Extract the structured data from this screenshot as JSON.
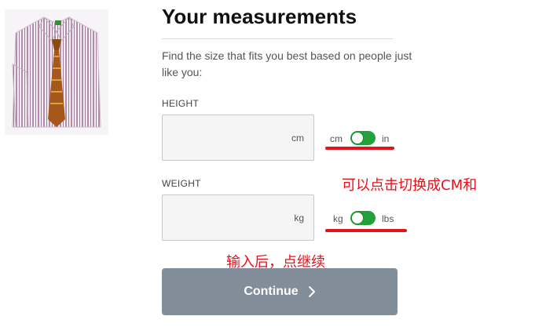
{
  "heading": "Your measurements",
  "subtitle": "Find the size that fits you best based on people just like you:",
  "height": {
    "label": "HEIGHT",
    "value": "",
    "unit_suffix": "cm",
    "toggle_left": "cm",
    "toggle_right": "in"
  },
  "weight": {
    "label": "WEIGHT",
    "value": "",
    "unit_suffix": "kg",
    "toggle_left": "kg",
    "toggle_right": "lbs"
  },
  "annotations": {
    "toggle_note": "可以点击切换成CM和",
    "continue_note": "输入后，点继续"
  },
  "continue_label": "Continue",
  "colors": {
    "toggle_on": "#21a13a",
    "continue_bg": "#818e9a",
    "annotation": "#e5121b"
  },
  "icons": {
    "product": "dress-shirt-with-tie",
    "continue": "chevron-right-icon"
  }
}
